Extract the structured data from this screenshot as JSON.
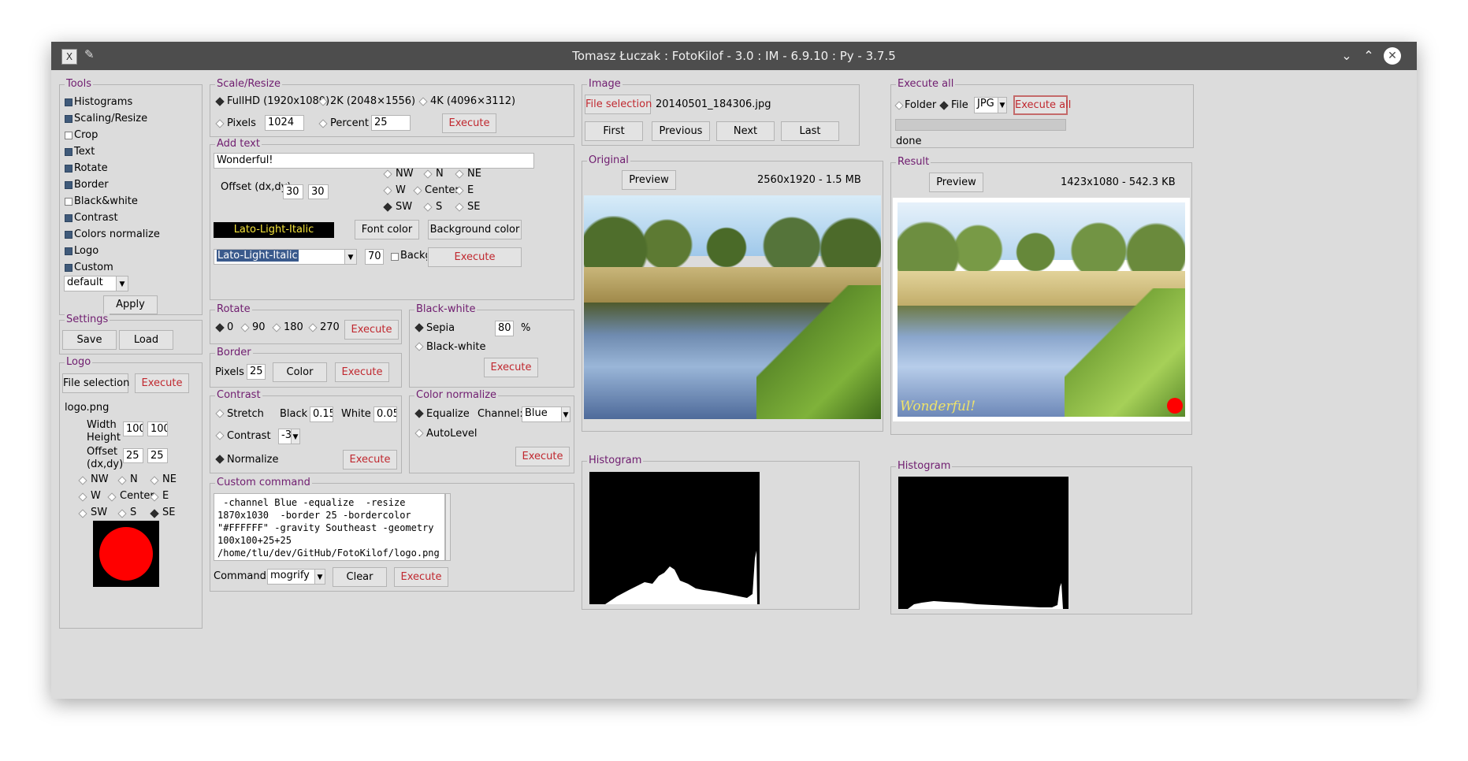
{
  "window": {
    "title": "Tomasz Łuczak : FotoKilof - 3.0 : IM - 6.9.10 : Py - 3.7.5"
  },
  "tools": {
    "legend": "Tools",
    "items": [
      {
        "label": "Histograms",
        "checked": true
      },
      {
        "label": "Scaling/Resize",
        "checked": true
      },
      {
        "label": "Crop",
        "checked": false
      },
      {
        "label": "Text",
        "checked": true
      },
      {
        "label": "Rotate",
        "checked": true
      },
      {
        "label": "Border",
        "checked": true
      },
      {
        "label": "Black&white",
        "checked": false
      },
      {
        "label": "Contrast",
        "checked": true
      },
      {
        "label": "Colors normalize",
        "checked": true
      },
      {
        "label": "Logo",
        "checked": true
      },
      {
        "label": "Custom",
        "checked": true
      }
    ],
    "profile": "default",
    "apply": "Apply"
  },
  "settings": {
    "legend": "Settings",
    "save": "Save",
    "load": "Load"
  },
  "logo": {
    "legend": "Logo",
    "file_selection": "File selection",
    "execute": "Execute",
    "filename": "logo.png",
    "width_label": "Width",
    "height_label": "Height",
    "width": "100",
    "height": "100",
    "offset_label1": "Offset",
    "offset_label2": "(dx,dy)",
    "dx": "25",
    "dy": "25",
    "pos": {
      "nw": "NW",
      "n": "N",
      "ne": "NE",
      "w": "W",
      "center": "Center",
      "e": "E",
      "sw": "SW",
      "s": "S",
      "se": "SE"
    },
    "preview_color": "#ff0000"
  },
  "scale": {
    "legend": "Scale/Resize",
    "fullhd": "FullHD (1920x1080)",
    "k2": "2K (2048×1556)",
    "k4": "4K (4096×3112)",
    "pixels": "Pixels",
    "pixels_value": "1024",
    "percent": "Percent",
    "percent_value": "25",
    "execute": "Execute"
  },
  "text": {
    "legend": "Add text",
    "value": "Wonderful!",
    "offset_label": "Offset (dx,dy)",
    "dx": "30",
    "dy": "30",
    "pos": {
      "nw": "NW",
      "n": "N",
      "ne": "NE",
      "w": "W",
      "center": "Center",
      "e": "E",
      "sw": "SW",
      "s": "S",
      "se": "SE"
    },
    "font_preview": "Lato-Light-Italic",
    "font_color": "Font color",
    "background_color": "Background color",
    "font": "Lato-Light-Italic",
    "size": "70",
    "background_check": "Backgr",
    "execute": "Execute"
  },
  "rotate": {
    "legend": "Rotate",
    "r0": "0",
    "r90": "90",
    "r180": "180",
    "r270": "270",
    "execute": "Execute"
  },
  "bw": {
    "legend": "Black-white",
    "sepia": "Sepia",
    "sepia_value": "80",
    "percent": "%",
    "bw": "Black-white",
    "execute": "Execute"
  },
  "border": {
    "legend": "Border",
    "pixels": "Pixels",
    "value": "25",
    "color": "Color",
    "execute": "Execute"
  },
  "contrast": {
    "legend": "Contrast",
    "stretch": "Stretch",
    "black": "Black",
    "black_value": "0.15",
    "white": "White",
    "white_value": "0.05",
    "contrast": "Contrast",
    "contrast_value": "-3",
    "normalize": "Normalize",
    "execute": "Execute"
  },
  "normalize": {
    "legend": "Color normalize",
    "equalize": "Equalize",
    "channel_label": "Channel:",
    "channel": "Blue",
    "autolevel": "AutoLevel",
    "execute": "Execute"
  },
  "custom": {
    "legend": "Custom command",
    "text": " -channel Blue -equalize  -resize\n1870x1030  -border 25 -bordercolor\n\"#FFFFFF\" -gravity Southeast -geometry\n100x100+25+25\n/home/tlu/dev/GitHub/FotoKilof/logo.png",
    "command_label": "Command:",
    "command": "mogrify",
    "clear": "Clear",
    "execute": "Execute"
  },
  "image": {
    "legend": "Image",
    "file_selection": "File selection",
    "filename": "20140501_184306.jpg",
    "first": "First",
    "previous": "Previous",
    "next": "Next",
    "last": "Last"
  },
  "original": {
    "legend": "Original",
    "preview": "Preview",
    "info": "2560x1920 - 1.5 MB",
    "histogram": "Histogram"
  },
  "execute_all": {
    "legend": "Execute all",
    "folder": "Folder",
    "file": "File",
    "format": "JPG",
    "button": "Execute all",
    "status": "done"
  },
  "result": {
    "legend": "Result",
    "preview": "Preview",
    "info": "1423x1080 - 542.3 KB",
    "overlay_text": "Wonderful!",
    "histogram": "Histogram"
  }
}
